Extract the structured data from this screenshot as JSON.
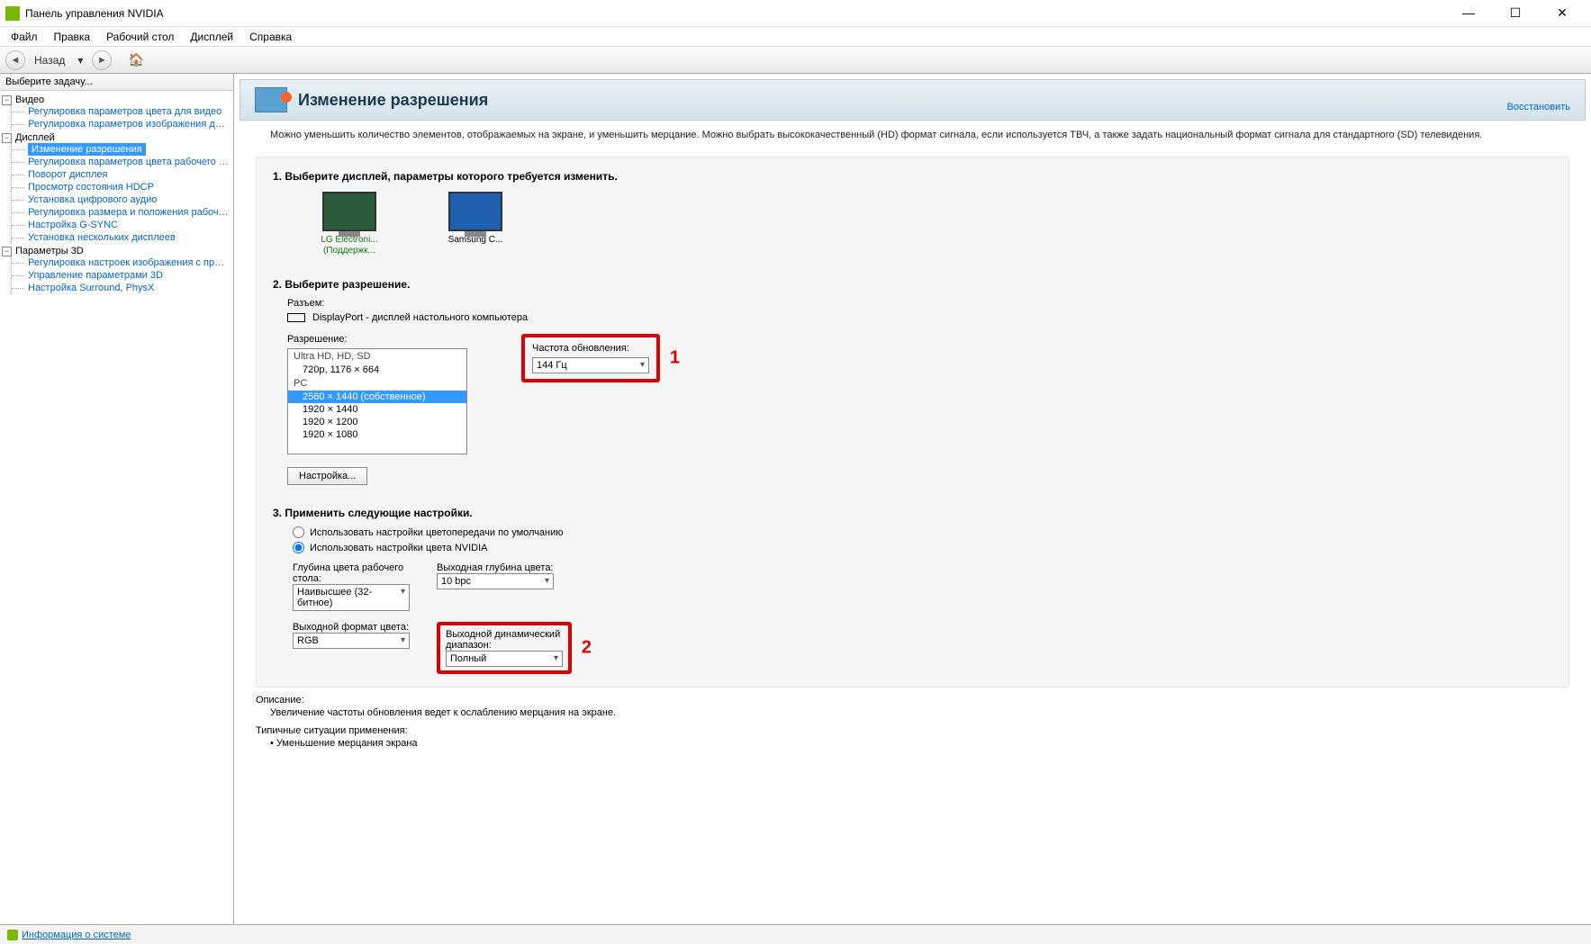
{
  "window": {
    "title": "Панель управления NVIDIA"
  },
  "menu": [
    "Файл",
    "Правка",
    "Рабочий стол",
    "Дисплей",
    "Справка"
  ],
  "toolbar": {
    "back_label": "Назад"
  },
  "side": {
    "header": "Выберите задачу...",
    "cats": [
      {
        "label": "Видео",
        "items": [
          "Регулировка параметров цвета для видео",
          "Регулировка параметров изображения для видео"
        ]
      },
      {
        "label": "Дисплей",
        "items": [
          "Изменение разрешения",
          "Регулировка параметров цвета рабочего стола",
          "Поворот дисплея",
          "Просмотр состояния HDCP",
          "Установка цифрового аудио",
          "Регулировка размера и положения рабочего стола",
          "Настройка G-SYNC",
          "Установка нескольких дисплеев"
        ],
        "selected": 0
      },
      {
        "label": "Параметры 3D",
        "items": [
          "Регулировка настроек изображения с просмотром",
          "Управление параметрами 3D",
          "Настройка Surround, PhysX"
        ]
      }
    ]
  },
  "page": {
    "title": "Изменение разрешения",
    "restore": "Восстановить",
    "description": "Можно уменьшить количество элементов, отображаемых на экране, и уменьшить мерцание. Можно выбрать высококачественный (HD) формат сигнала, если используется ТВЧ, а также задать национальный формат сигнала для стандартного (SD) телевидения.",
    "step1": "1. Выберите дисплей, параметры которого требуется изменить.",
    "displays": [
      {
        "name": "LG Electroni...",
        "sub": "(Поддержк...",
        "primary": true
      },
      {
        "name": "Samsung C...",
        "sub": "",
        "primary": false
      }
    ],
    "step2": "2. Выберите разрешение.",
    "port_label": "Разъем:",
    "port_value": "DisplayPort - дисплей настольного компьютера",
    "res_label": "Разрешение:",
    "res_groups": [
      {
        "group": "Ultra HD, HD, SD",
        "items": [
          "720p, 1176 × 664"
        ]
      },
      {
        "group": "PC",
        "items": [
          "2560 × 1440 (собственное)",
          "1920 × 1440",
          "1920 × 1200",
          "1920 × 1080"
        ]
      }
    ],
    "res_selected": "2560 × 1440 (собственное)",
    "refresh_label": "Частота обновления:",
    "refresh_value": "144 Гц",
    "annotation1": "1",
    "customize_btn": "Настройка...",
    "step3": "3. Применить следующие настройки.",
    "radio_default": "Использовать настройки цветопередачи по умолчанию",
    "radio_nvidia": "Использовать настройки цвета NVIDIA",
    "radio_selected": "nvidia",
    "color_depth_label": "Глубина цвета рабочего стола:",
    "color_depth_value": "Наивысшее (32-битное)",
    "output_depth_label": "Выходная глубина цвета:",
    "output_depth_value": "10 bpc",
    "output_format_label": "Выходной формат цвета:",
    "output_format_value": "RGB",
    "output_range_label": "Выходной динамический диапазон:",
    "output_range_value": "Полный",
    "annotation2": "2",
    "desc_title": "Описание:",
    "desc_body": "Увеличение частоты обновления ведет к ослаблению мерцания на экране.",
    "typical_title": "Типичные ситуации применения:",
    "typical_item": "Уменьшение мерцания экрана"
  },
  "status": {
    "sysinfo": "Информация о системе"
  }
}
